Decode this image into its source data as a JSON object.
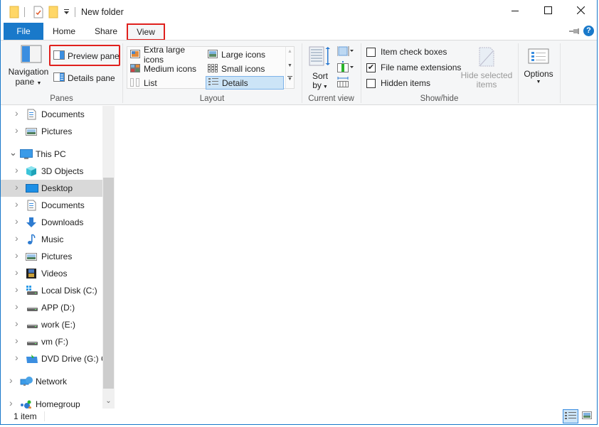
{
  "window": {
    "title": "New folder",
    "controls": {
      "minimize": "minimize-icon",
      "maximize": "maximize-icon",
      "close": "close-icon"
    }
  },
  "quick_access": [
    {
      "icon": "folder-icon"
    },
    {
      "icon": "properties-icon"
    },
    {
      "icon": "new-folder-icon"
    },
    {
      "icon": "customize-dropdown-icon"
    }
  ],
  "tabs": [
    {
      "label": "File",
      "active": false
    },
    {
      "label": "Home",
      "active": false
    },
    {
      "label": "Share",
      "active": false
    },
    {
      "label": "View",
      "active": true,
      "highlighted": true
    }
  ],
  "ribbon": {
    "pin_icon": "pin-icon",
    "help_icon": "help-icon",
    "panes": {
      "label": "Panes",
      "navigation_pane": {
        "line1": "Navigation",
        "line2": "pane"
      },
      "preview_pane": "Preview pane",
      "details_pane": "Details pane"
    },
    "layout": {
      "label": "Layout",
      "items": [
        {
          "label": "Extra large icons",
          "selected": false
        },
        {
          "label": "Large icons",
          "selected": false
        },
        {
          "label": "Medium icons",
          "selected": false
        },
        {
          "label": "Small icons",
          "selected": false
        },
        {
          "label": "List",
          "selected": false
        },
        {
          "label": "Details",
          "selected": true
        }
      ]
    },
    "current_view": {
      "label": "Current view",
      "sort_by": {
        "line1": "Sort",
        "line2": "by"
      }
    },
    "show_hide": {
      "label": "Show/hide",
      "checkboxes": [
        {
          "label": "Item check boxes",
          "checked": false
        },
        {
          "label": "File name extensions",
          "checked": true
        },
        {
          "label": "Hidden items",
          "checked": false
        }
      ],
      "hide_selected": {
        "line1": "Hide selected",
        "line2": "items",
        "disabled": true
      }
    },
    "options": {
      "label": "Options"
    }
  },
  "nav": {
    "items": [
      {
        "label": "Documents",
        "icon": "documents-icon",
        "level": 1,
        "expand": "collapsed"
      },
      {
        "label": "Pictures",
        "icon": "pictures-icon",
        "level": 1,
        "expand": "collapsed"
      },
      {
        "label": "This PC",
        "icon": "computer-icon",
        "level": 0,
        "expand": "expanded"
      },
      {
        "label": "3D Objects",
        "icon": "3d-objects-icon",
        "level": 1,
        "expand": "collapsed"
      },
      {
        "label": "Desktop",
        "icon": "desktop-icon",
        "level": 1,
        "expand": "collapsed",
        "selected": true
      },
      {
        "label": "Documents",
        "icon": "documents-icon",
        "level": 1,
        "expand": "collapsed"
      },
      {
        "label": "Downloads",
        "icon": "downloads-icon",
        "level": 1,
        "expand": "collapsed"
      },
      {
        "label": "Music",
        "icon": "music-icon",
        "level": 1,
        "expand": "collapsed"
      },
      {
        "label": "Pictures",
        "icon": "pictures-icon",
        "level": 1,
        "expand": "collapsed"
      },
      {
        "label": "Videos",
        "icon": "videos-icon",
        "level": 1,
        "expand": "collapsed"
      },
      {
        "label": "Local Disk (C:)",
        "icon": "system-drive-icon",
        "level": 1,
        "expand": "collapsed"
      },
      {
        "label": "APP (D:)",
        "icon": "drive-icon",
        "level": 1,
        "expand": "collapsed"
      },
      {
        "label": "work (E:)",
        "icon": "drive-icon",
        "level": 1,
        "expand": "collapsed"
      },
      {
        "label": "vm (F:)",
        "icon": "drive-icon",
        "level": 1,
        "expand": "collapsed"
      },
      {
        "label": "DVD Drive (G:) C",
        "icon": "dvd-drive-icon",
        "level": 1,
        "expand": "collapsed"
      },
      {
        "label": "Network",
        "icon": "network-icon",
        "level": 0,
        "expand": "collapsed"
      },
      {
        "label": "Homegroup",
        "icon": "homegroup-icon",
        "level": 0,
        "expand": "collapsed"
      }
    ]
  },
  "status": {
    "item_count": "1 item",
    "view_buttons": [
      {
        "name": "details-view",
        "active": true
      },
      {
        "name": "large-icons-view",
        "active": false
      }
    ]
  },
  "colors": {
    "accent": "#1979ca",
    "highlight_box": "#e0201d",
    "selected_nav": "#d9d9d9",
    "selected_layout": "#cce4f7",
    "ribbon_bg": "#f5f6f7"
  }
}
